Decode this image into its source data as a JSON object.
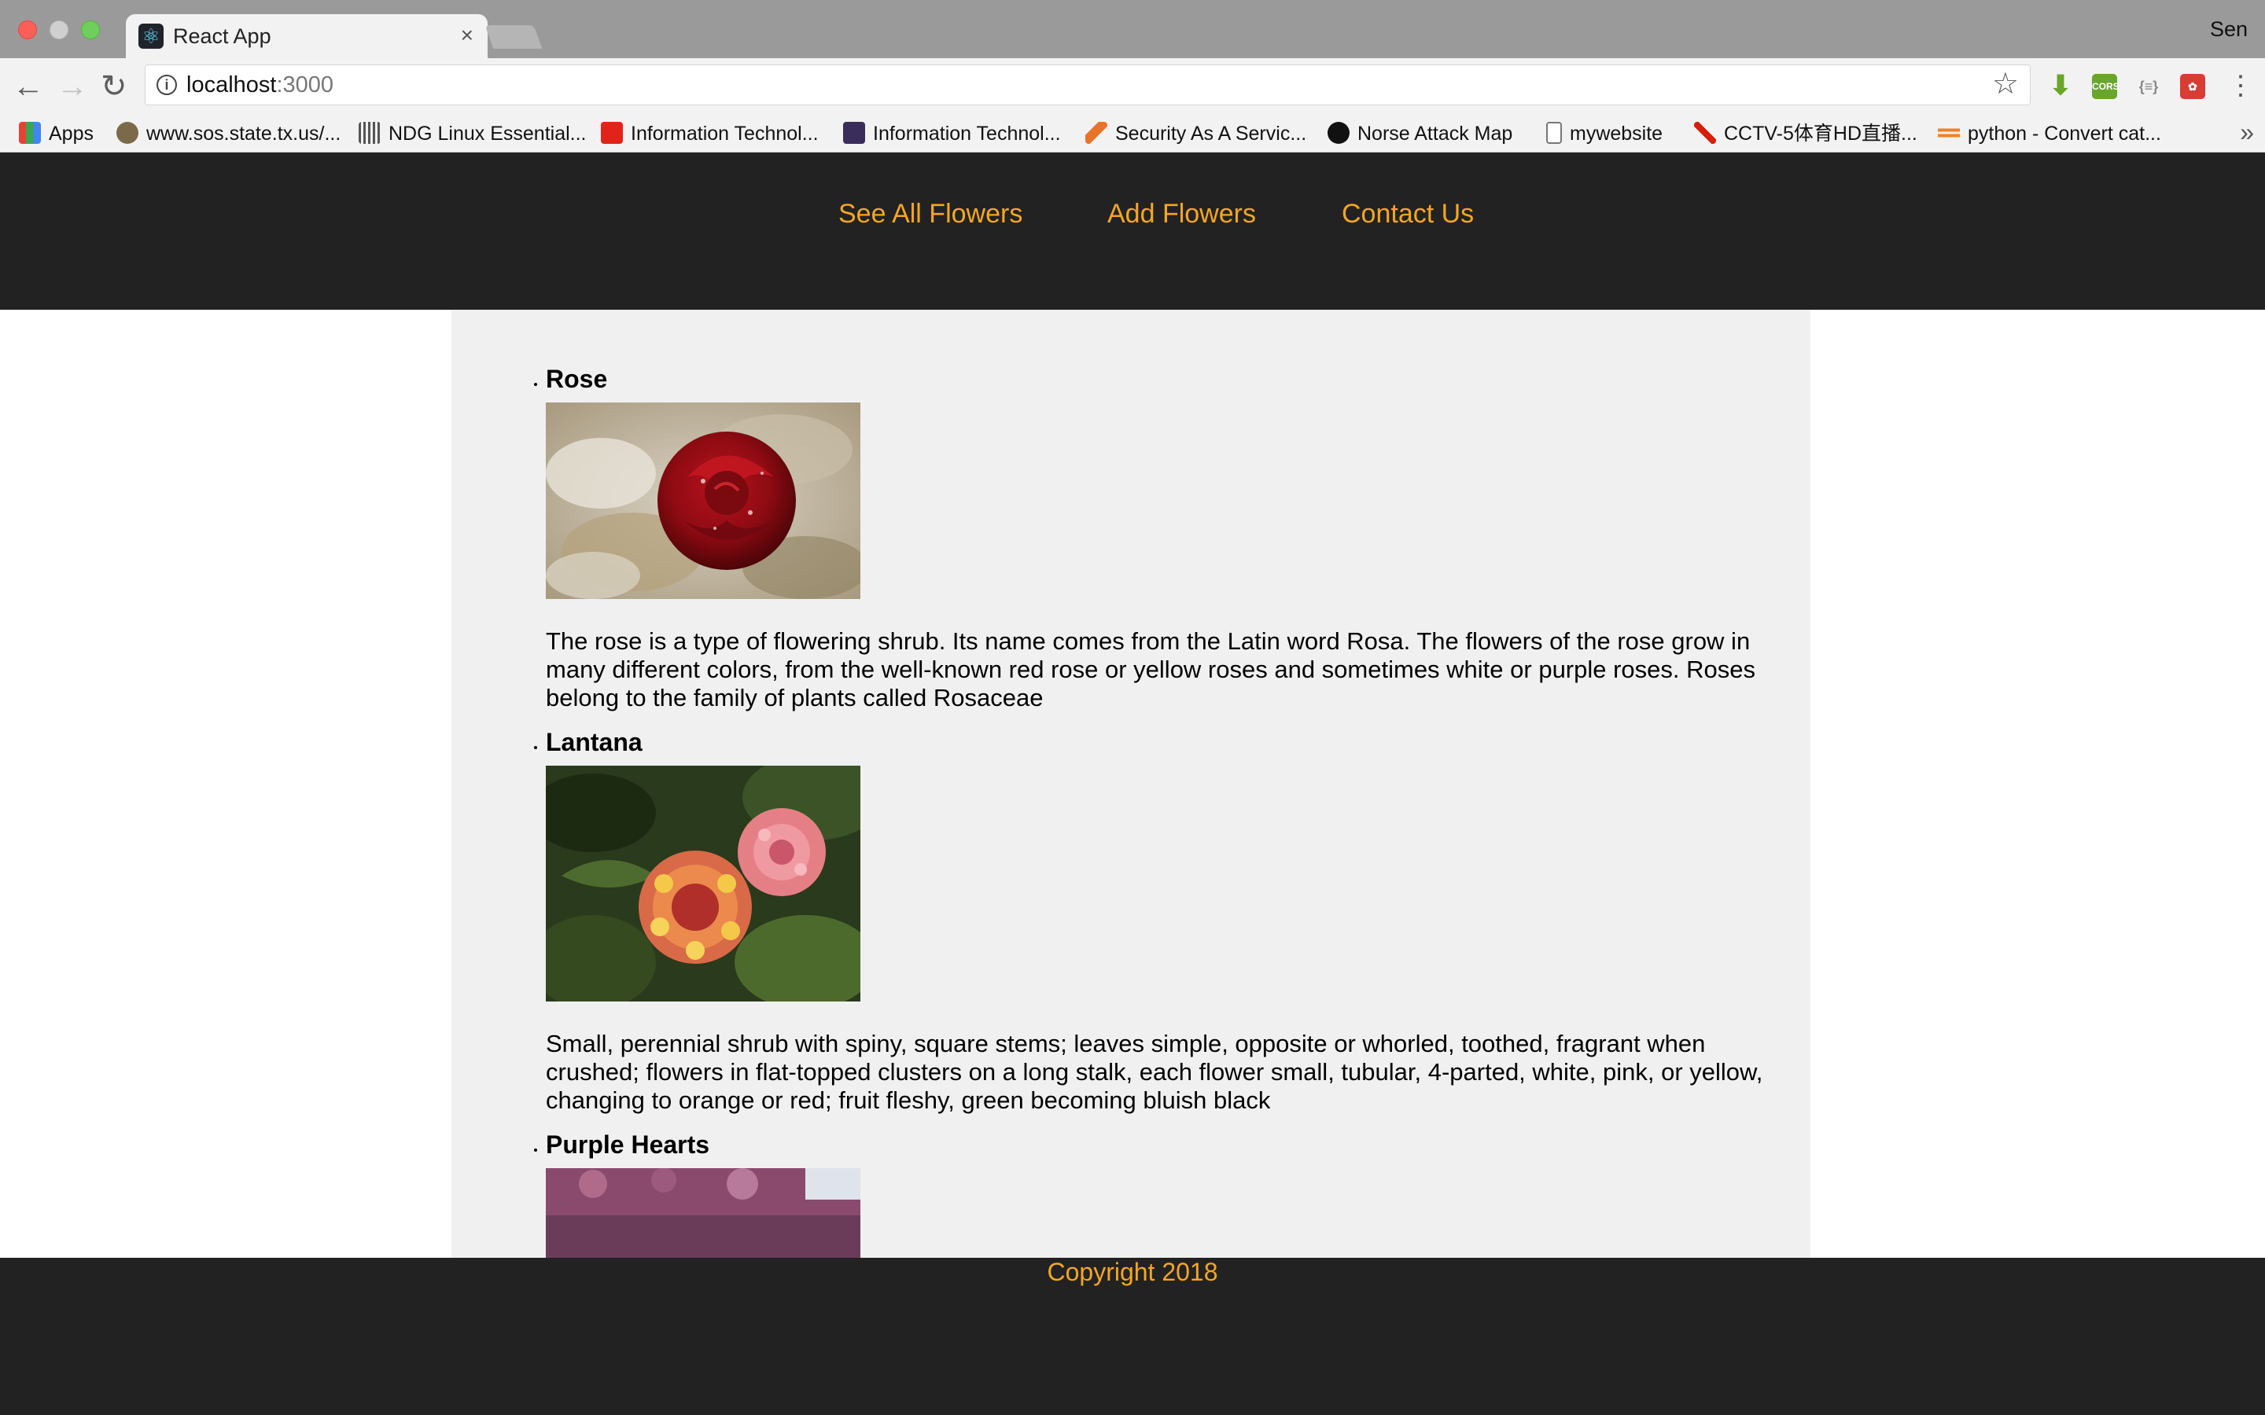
{
  "browser": {
    "tab_title": "React App",
    "tab_close": "×",
    "profile_name": "Sen",
    "url_host": "localhost",
    "url_port": ":3000",
    "bookmarks": [
      "Apps",
      "www.sos.state.tx.us/...",
      "NDG Linux Essential...",
      "Information Technol...",
      "Information Technol...",
      "Security As A Servic...",
      "Norse Attack Map",
      "mywebsite",
      "CCTV-5体育HD直播...",
      "python - Convert cat..."
    ],
    "bookmarks_more": "»",
    "extensions": [
      "download-icon",
      "cors-icon",
      "json-viewer-icon",
      "red-extension-icon"
    ]
  },
  "nav": {
    "links": [
      "See All Flowers",
      "Add Flowers",
      "Contact Us"
    ],
    "color": "#f5a623"
  },
  "flowers": [
    {
      "name": "Rose",
      "image": "red-rose-photo",
      "description": "The rose is a type of flowering shrub. Its name comes from the Latin word Rosa. The flowers of the rose grow in many different colors, from the well-known red rose or yellow roses and sometimes white or purple roses. Roses belong to the family of plants called Rosaceae"
    },
    {
      "name": "Lantana",
      "image": "lantana-photo",
      "description": "Small, perennial shrub with spiny, square stems; leaves simple, opposite or whorled, toothed, fragrant when crushed; flowers in flat-topped clusters on a long stalk, each flower small, tubular, 4-parted, white, pink, or yellow, changing to orange or red; fruit fleshy, green becoming bluish black"
    },
    {
      "name": "Purple Hearts",
      "image": "purple-hearts-photo"
    }
  ],
  "footer": {
    "copyright": "Copyright 2018"
  },
  "colors": {
    "header_bg": "#222222",
    "content_bg": "#f0f0f0",
    "accent": "#f5a623"
  }
}
